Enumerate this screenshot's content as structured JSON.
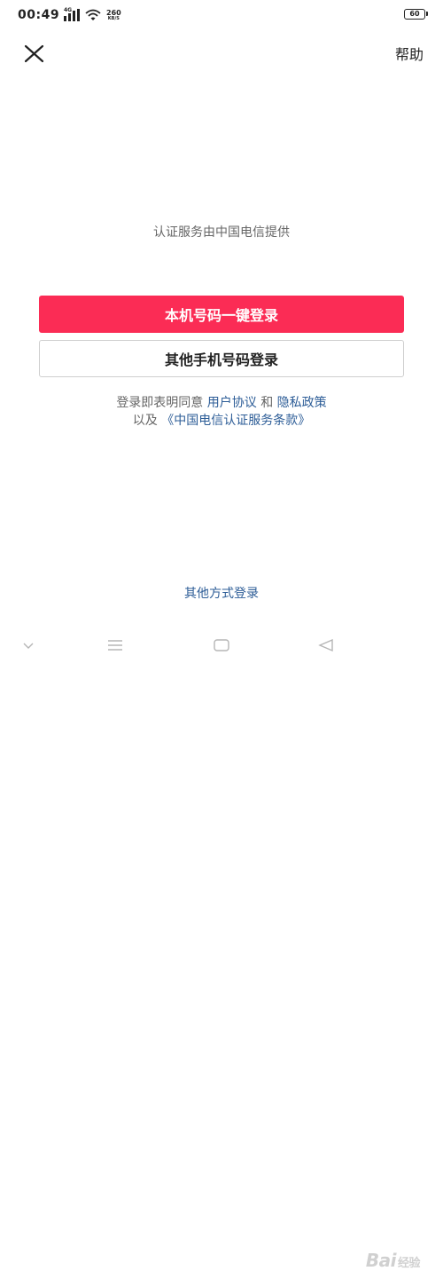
{
  "status_bar": {
    "time": "00:49",
    "network_label": "4G",
    "net_speed_value": "260",
    "net_speed_unit": "KB/S",
    "battery": "60",
    "icons": [
      "signal-icon",
      "wifi-icon",
      "battery-icon"
    ]
  },
  "header": {
    "close_icon": "close-icon",
    "help_label": "帮助"
  },
  "main": {
    "provider_text": "认证服务由中国电信提供",
    "one_click_login_label": "本机号码一键登录",
    "other_phone_login_label": "其他手机号码登录"
  },
  "agreement": {
    "prefix": "登录即表明同意",
    "user_agreement": "用户协议",
    "and": "和",
    "privacy_policy": "隐私政策",
    "and_also": "以及",
    "telecom_terms": "《中国电信认证服务条款》"
  },
  "footer": {
    "other_login_label": "其他方式登录"
  },
  "nav_bar": {
    "icons": [
      "collapse-chevron-icon",
      "menu-icon",
      "home-icon",
      "back-icon"
    ]
  },
  "watermark": {
    "brand": "Bai",
    "suffix": "经验"
  },
  "colors": {
    "primary": "#fb2c55",
    "link": "#2d5d97",
    "muted_text": "#666666",
    "border": "#cfcfcf"
  }
}
